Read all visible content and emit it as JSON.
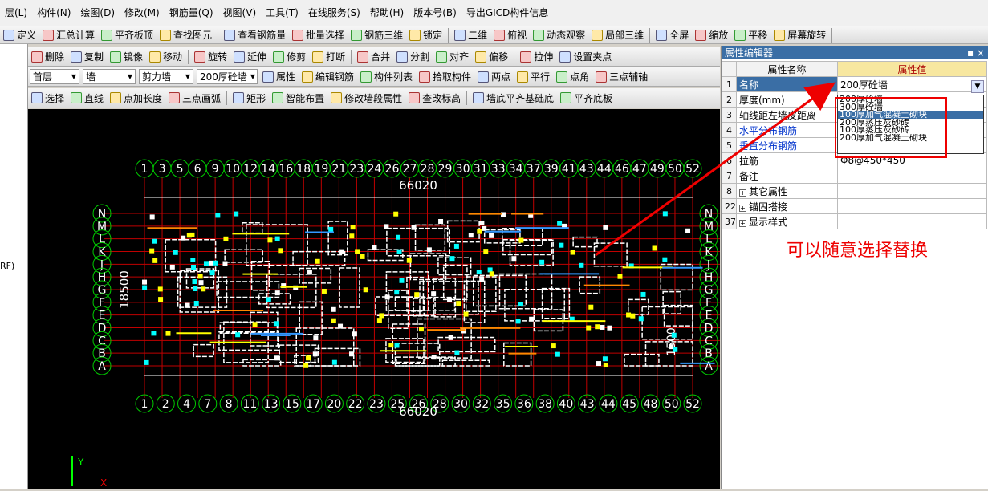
{
  "menu": [
    "层(L)",
    "构件(N)",
    "绘图(D)",
    "修改(M)",
    "钢筋量(Q)",
    "视图(V)",
    "工具(T)",
    "在线服务(S)",
    "帮助(H)",
    "版本号(B)",
    "导出GICD构件信息"
  ],
  "toolbar1": [
    "定义",
    "汇总计算",
    "平齐板顶",
    "查找图元",
    "查看钢筋量",
    "批量选择",
    "钢筋三维",
    "锁定",
    "二维",
    "俯视",
    "动态观察",
    "局部三维",
    "全屏",
    "缩放",
    "平移",
    "屏幕旋转"
  ],
  "toolbar2": [
    "删除",
    "复制",
    "镜像",
    "移动",
    "旋转",
    "延伸",
    "修剪",
    "打断",
    "合并",
    "分割",
    "对齐",
    "偏移",
    "拉伸",
    "设置夹点"
  ],
  "toolbar3": {
    "floor": "首层",
    "type": "墙",
    "subtype": "剪力墙",
    "element": "200厚砼墙",
    "buttons": [
      "属性",
      "编辑钢筋",
      "构件列表",
      "拾取构件",
      "两点",
      "平行",
      "点角",
      "三点辅轴"
    ]
  },
  "toolbar4": [
    "选择",
    "直线",
    "点加长度",
    "三点画弧",
    "矩形",
    "智能布置",
    "修改墙段属性",
    "查改标高",
    "墙底平齐基础底",
    "平齐底板"
  ],
  "left_strip_text": "RF)",
  "panel": {
    "title": "属性编辑器",
    "pin": "▪ ×",
    "header_name": "属性名称",
    "header_value": "属性值",
    "rows": [
      {
        "num": "1",
        "name": "名称",
        "value": "200厚砼墙"
      },
      {
        "num": "2",
        "name": "厚度(mm)",
        "value": ""
      },
      {
        "num": "3",
        "name": "轴线距左墙皮距离",
        "value": ""
      },
      {
        "num": "4",
        "name": "水平分布钢筋",
        "value": ""
      },
      {
        "num": "5",
        "name": "垂直分布钢筋",
        "value": ""
      },
      {
        "num": "6",
        "name": "拉筋",
        "value": "Φ8@450*450"
      },
      {
        "num": "7",
        "name": "备注",
        "value": ""
      },
      {
        "num": "8",
        "name": "其它属性",
        "value": ""
      },
      {
        "num": "22",
        "name": "锚固搭接",
        "value": ""
      },
      {
        "num": "37",
        "name": "显示样式",
        "value": ""
      }
    ],
    "dropdown_options": [
      "200厚砼墙",
      "300厚砼墙",
      "100厚加气混凝土砌块",
      "200厚蒸压灰砂砖",
      "100厚蒸压灰砂砖",
      "200厚加气混凝土砌块"
    ]
  },
  "canvas": {
    "top_axes": [
      "1",
      "3",
      "5",
      "6",
      "9",
      "10",
      "12",
      "14",
      "16",
      "18",
      "19",
      "21",
      "23",
      "24",
      "26",
      "27",
      "28",
      "29",
      "30",
      "31",
      "33",
      "34",
      "37",
      "39",
      "41",
      "43",
      "44",
      "46",
      "47",
      "49",
      "50",
      "52"
    ],
    "bottom_axes": [
      "1",
      "2",
      "4",
      "7",
      "8",
      "11",
      "13",
      "15",
      "17",
      "20",
      "22",
      "23",
      "25",
      "26",
      "28",
      "30",
      "32",
      "35",
      "36",
      "38",
      "40",
      "43",
      "44",
      "45",
      "48",
      "50",
      "52"
    ],
    "left_axes": [
      "N",
      "M",
      "L",
      "K",
      "J",
      "H",
      "G",
      "F",
      "E",
      "D",
      "C",
      "B",
      "A"
    ],
    "total_dim": "66020",
    "side_dim": "18500",
    "side_dim2": "1500",
    "y_label": "Y",
    "x_label": "X"
  },
  "annotation": "可以随意选择替换",
  "colors": {
    "grid_red": "#c00000",
    "wall_white": "#ffffff",
    "axis_green": "#00cc00",
    "highlight": "#e00000"
  }
}
